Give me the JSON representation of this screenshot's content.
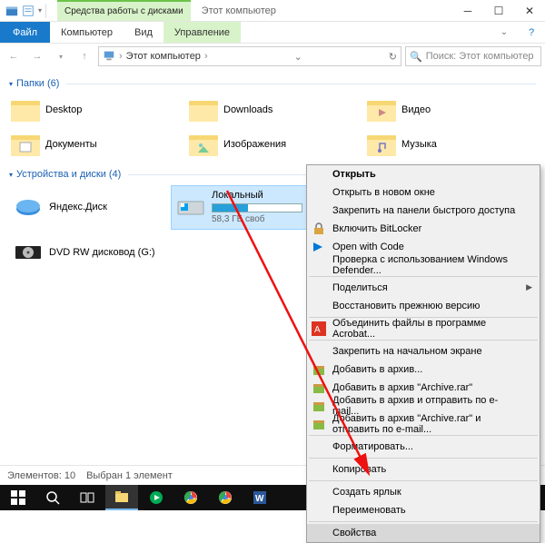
{
  "titlebar": {
    "ribbon_category": "Средства работы с дисками",
    "window_title": "Этот компьютер"
  },
  "menu": {
    "file": "Файл",
    "computer": "Компьютер",
    "view": "Вид",
    "manage": "Управление"
  },
  "address": {
    "path_root": "Этот компьютер",
    "search_placeholder": "Поиск: Этот компьютер"
  },
  "groups": {
    "folders_title": "Папки (6)",
    "devices_title": "Устройства и диски (4)"
  },
  "folders": [
    {
      "label": "Desktop"
    },
    {
      "label": "Downloads"
    },
    {
      "label": "Видео"
    },
    {
      "label": "Документы"
    },
    {
      "label": "Изображения"
    },
    {
      "label": "Музыка"
    }
  ],
  "devices": {
    "yandex": {
      "label": "Яндекс.Диск"
    },
    "local": {
      "label": "Локальный",
      "sub": "58,3 ГБ своб"
    },
    "dvd": {
      "label": "DVD RW дисковод (G:)"
    }
  },
  "context_menu": {
    "open": "Открыть",
    "open_new": "Открыть в новом окне",
    "pin_quick": "Закрепить на панели быстрого доступа",
    "bitlocker": "Включить BitLocker",
    "open_code": "Open with Code",
    "defender": "Проверка с использованием Windows Defender...",
    "share": "Поделиться",
    "restore": "Восстановить прежнюю версию",
    "acrobat": "Объединить файлы в программе Acrobat...",
    "pin_start": "Закрепить на начальном экране",
    "add_archive": "Добавить в архив...",
    "add_archive_rar": "Добавить в архив \"Archive.rar\"",
    "add_send": "Добавить в архив и отправить по e-mail...",
    "add_rar_send": "Добавить в архив \"Archive.rar\" и отправить по e-mail...",
    "format": "Форматировать...",
    "copy": "Копировать",
    "create_shortcut": "Создать ярлык",
    "rename": "Переименовать",
    "properties": "Свойства"
  },
  "status": {
    "elements": "Элементов: 10",
    "selected": "Выбран 1 элемент"
  }
}
